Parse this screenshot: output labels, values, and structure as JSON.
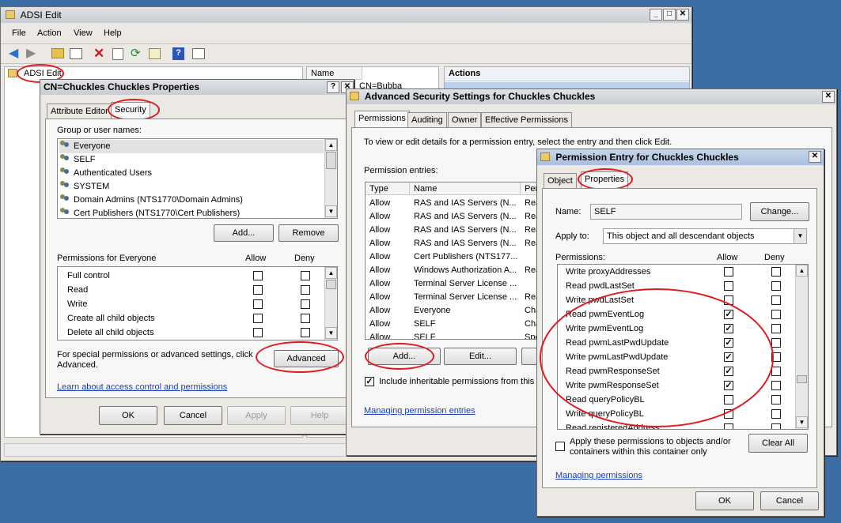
{
  "main": {
    "title": "ADSI Edit",
    "menu": [
      "File",
      "Action",
      "View",
      "Help"
    ],
    "tree_root": "ADSI Edit",
    "list_header": "Name",
    "list_item": "CN=Bubba",
    "actions_header": "Actions"
  },
  "props": {
    "title": "CN=Chuckles Chuckles Properties",
    "tabs": [
      "Attribute Editor",
      "Security"
    ],
    "group_label": "Group or user names:",
    "users": [
      "Everyone",
      "SELF",
      "Authenticated Users",
      "SYSTEM",
      "Domain Admins (NTS1770\\Domain Admins)",
      "Cert Publishers (NTS1770\\Cert Publishers)"
    ],
    "add_btn": "Add...",
    "remove_btn": "Remove",
    "perm_label": "Permissions for Everyone",
    "allow": "Allow",
    "deny": "Deny",
    "perms": [
      "Full control",
      "Read",
      "Write",
      "Create all child objects",
      "Delete all child objects"
    ],
    "special_text": "For special permissions or advanced settings, click Advanced.",
    "advanced_btn": "Advanced",
    "learn_link": "Learn about access control and permissions",
    "ok": "OK",
    "cancel": "Cancel",
    "apply": "Apply",
    "help": "Help"
  },
  "adv": {
    "title": "Advanced Security Settings for Chuckles Chuckles",
    "tabs": [
      "Permissions",
      "Auditing",
      "Owner",
      "Effective Permissions"
    ],
    "intro": "To view or edit details for a permission entry, select the entry and then click Edit.",
    "entries_label": "Permission entries:",
    "col_type": "Type",
    "col_name": "Name",
    "col_perm": "Per",
    "entries": [
      {
        "type": "Allow",
        "name": "RAS and IAS Servers (N...",
        "perm": "Rea"
      },
      {
        "type": "Allow",
        "name": "RAS and IAS Servers (N...",
        "perm": "Rea"
      },
      {
        "type": "Allow",
        "name": "RAS and IAS Servers (N...",
        "perm": "Rea"
      },
      {
        "type": "Allow",
        "name": "RAS and IAS Servers (N...",
        "perm": "Rea"
      },
      {
        "type": "Allow",
        "name": "Cert Publishers (NTS177...",
        "perm": ""
      },
      {
        "type": "Allow",
        "name": "Windows Authorization A...",
        "perm": "Rea"
      },
      {
        "type": "Allow",
        "name": "Terminal Server License ...",
        "perm": ""
      },
      {
        "type": "Allow",
        "name": "Terminal Server License ...",
        "perm": "Rea"
      },
      {
        "type": "Allow",
        "name": "Everyone",
        "perm": "Cha"
      },
      {
        "type": "Allow",
        "name": "SELF",
        "perm": "Cha"
      },
      {
        "type": "Allow",
        "name": "SELF",
        "perm": "Spe"
      }
    ],
    "add_btn": "Add...",
    "edit_btn": "Edit...",
    "inherit_label": "Include inheritable permissions from this ob",
    "manage_link": "Managing permission entries"
  },
  "entry": {
    "title": "Permission Entry for Chuckles Chuckles",
    "tabs": [
      "Object",
      "Properties"
    ],
    "name_label": "Name:",
    "name_value": "SELF",
    "change_btn": "Change...",
    "apply_to_label": "Apply to:",
    "apply_to_value": "This object and all descendant objects",
    "perms_label": "Permissions:",
    "allow": "Allow",
    "deny": "Deny",
    "perms": [
      {
        "name": "Write proxyAddresses",
        "allow": false,
        "deny": false
      },
      {
        "name": "Read pwdLastSet",
        "allow": false,
        "deny": false
      },
      {
        "name": "Write pwdLastSet",
        "allow": false,
        "deny": false
      },
      {
        "name": "Read pwmEventLog",
        "allow": true,
        "deny": false
      },
      {
        "name": "Write pwmEventLog",
        "allow": true,
        "deny": false
      },
      {
        "name": "Read pwmLastPwdUpdate",
        "allow": true,
        "deny": false
      },
      {
        "name": "Write pwmLastPwdUpdate",
        "allow": true,
        "deny": false
      },
      {
        "name": "Read pwmResponseSet",
        "allow": true,
        "deny": false
      },
      {
        "name": "Write pwmResponseSet",
        "allow": true,
        "deny": false
      },
      {
        "name": "Read queryPolicyBL",
        "allow": false,
        "deny": false
      },
      {
        "name": "Write queryPolicyBL",
        "allow": false,
        "deny": false
      },
      {
        "name": "Read registeredAddress",
        "allow": false,
        "deny": false
      }
    ],
    "apply_children": "Apply these permissions to objects and/or containers within this container only",
    "clear_all_btn": "Clear All",
    "manage_link": "Managing permissions",
    "ok": "OK",
    "cancel": "Cancel"
  }
}
